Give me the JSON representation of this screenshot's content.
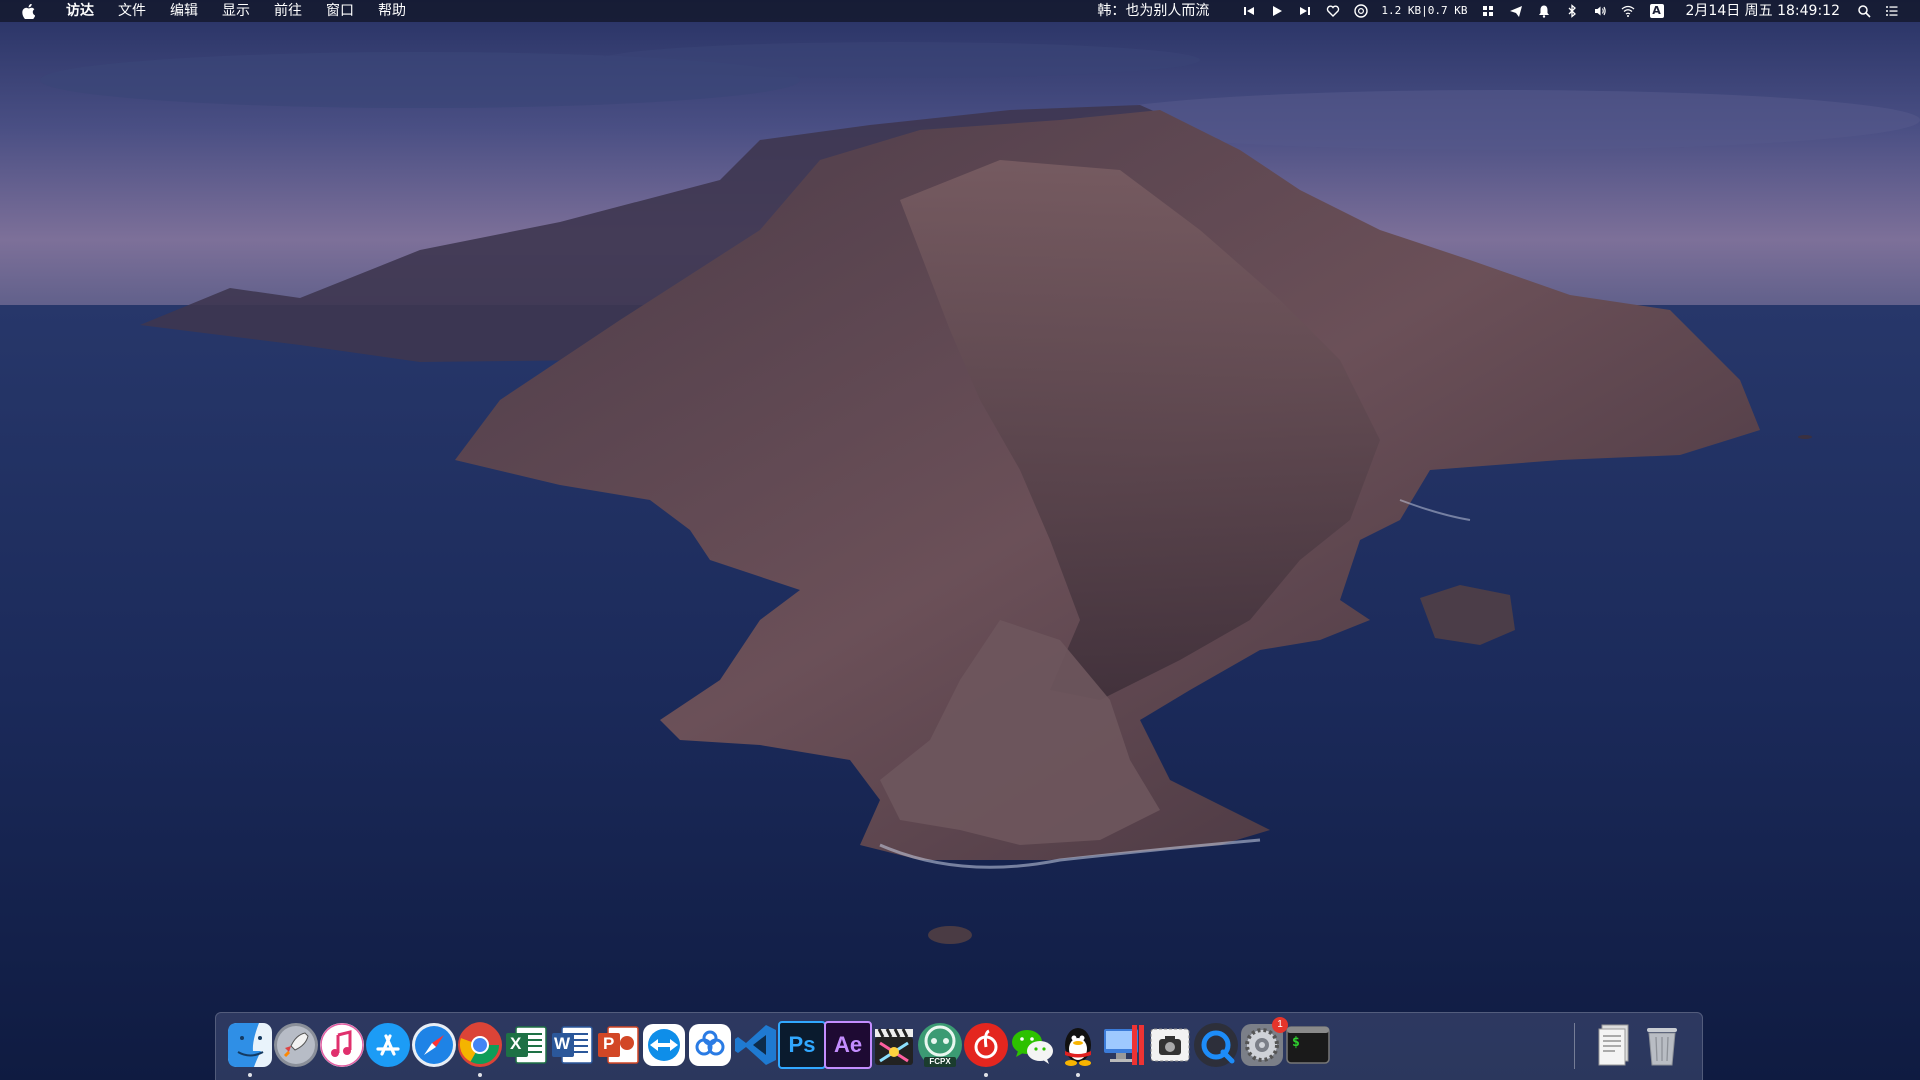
{
  "menubar": {
    "app_menus": [
      "访达",
      "文件",
      "编辑",
      "显示",
      "前往",
      "窗口",
      "帮助"
    ],
    "now_playing": "韩：也为别人而流",
    "network_speed": "1.2 KB|0.7 KB",
    "input_method": "A",
    "clock": "2月14日 周五 18:49:12",
    "status_icons": [
      "previous-track-icon",
      "play-icon",
      "next-track-icon",
      "heart-icon",
      "netease-music-icon",
      "network-monitor",
      "grid-app-icon",
      "send-icon",
      "notification-bell-icon",
      "bluetooth-icon",
      "volume-icon",
      "wifi-icon",
      "input-method-icon",
      "spotlight-search-icon",
      "notification-center-icon"
    ]
  },
  "dock": {
    "apps": [
      {
        "id": "finder",
        "icon": "finder-icon",
        "running": true
      },
      {
        "id": "launchpad",
        "icon": "launchpad-rocket-icon",
        "running": false
      },
      {
        "id": "music",
        "icon": "itunes-music-icon",
        "running": false
      },
      {
        "id": "app-store",
        "icon": "app-store-icon",
        "running": false
      },
      {
        "id": "safari",
        "icon": "safari-compass-icon",
        "running": false
      },
      {
        "id": "chrome",
        "icon": "chrome-icon",
        "running": true
      },
      {
        "id": "excel",
        "icon": "excel-icon",
        "label": "X",
        "running": false
      },
      {
        "id": "word",
        "icon": "word-icon",
        "label": "W",
        "running": false
      },
      {
        "id": "powerpoint",
        "icon": "powerpoint-icon",
        "label": "P",
        "running": false
      },
      {
        "id": "teamviewer",
        "icon": "teamviewer-icon",
        "running": false
      },
      {
        "id": "baidu-netdisk",
        "icon": "baidu-netdisk-icon",
        "running": false
      },
      {
        "id": "vscode",
        "icon": "vscode-icon",
        "running": false
      },
      {
        "id": "photoshop",
        "icon": "photoshop-icon",
        "label": "Ps",
        "running": false
      },
      {
        "id": "after-effects",
        "icon": "after-effects-icon",
        "label": "Ae",
        "running": false
      },
      {
        "id": "final-cut-pro",
        "icon": "final-cut-pro-icon",
        "running": false
      },
      {
        "id": "fcpx-toolbox",
        "icon": "fcpx-toolbox-icon",
        "label": "FCPX",
        "running": false
      },
      {
        "id": "netease-music",
        "icon": "netease-cloud-music-icon",
        "running": true
      },
      {
        "id": "wechat",
        "icon": "wechat-icon",
        "running": false
      },
      {
        "id": "qq",
        "icon": "qq-penguin-icon",
        "running": true
      },
      {
        "id": "parallels",
        "icon": "parallels-icon",
        "running": false
      },
      {
        "id": "screenshot",
        "icon": "screenshot-camera-icon",
        "running": false
      },
      {
        "id": "quicktime",
        "icon": "quicktime-icon",
        "running": false
      },
      {
        "id": "system-preferences",
        "icon": "system-preferences-gear-icon",
        "badge": "1",
        "running": false
      },
      {
        "id": "terminal",
        "icon": "terminal-icon",
        "label": "$",
        "running": false
      },
      {
        "id": "documents",
        "icon": "documents-stack-icon",
        "running": false
      },
      {
        "id": "trash",
        "icon": "trash-icon",
        "running": false
      }
    ]
  },
  "colors": {
    "menubar_bg": "#14182c",
    "sea": "#1a2a58",
    "island": "#5a4650",
    "badge": "#e5352b"
  }
}
